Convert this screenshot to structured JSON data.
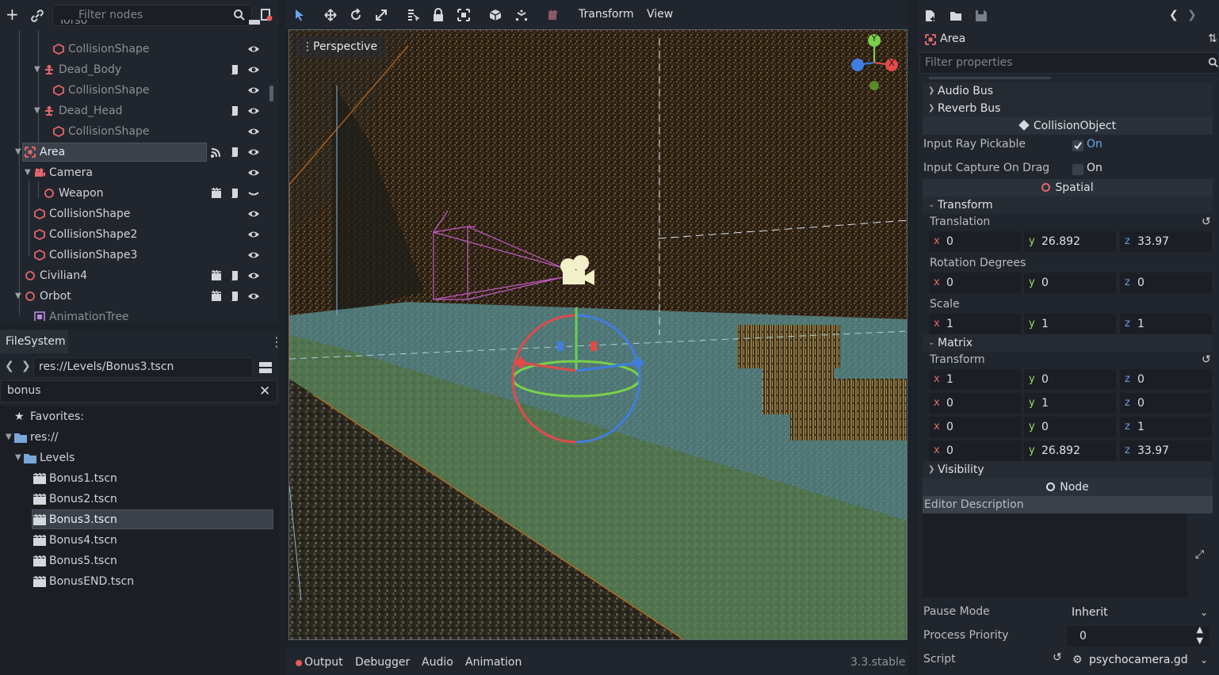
{
  "scene": {
    "filter_placeholder": "Filter nodes",
    "nodes": [
      {
        "label": "Torso"
      },
      {
        "label": "CollisionShape"
      },
      {
        "label": "Dead_Body"
      },
      {
        "label": "CollisionShape"
      },
      {
        "label": "Dead_Head"
      },
      {
        "label": "CollisionShape"
      },
      {
        "label": "Area"
      },
      {
        "label": "Camera"
      },
      {
        "label": "Weapon"
      },
      {
        "label": "CollisionShape"
      },
      {
        "label": "CollisionShape2"
      },
      {
        "label": "CollisionShape3"
      },
      {
        "label": "Civilian4"
      },
      {
        "label": "Orbot"
      },
      {
        "label": "AnimationTree"
      }
    ]
  },
  "filesystem": {
    "tab": "FileSystem",
    "path": "res://Levels/Bonus3.tscn",
    "search": "bonus",
    "favorites": "Favorites:",
    "root": "res://",
    "folder": "Levels",
    "files": [
      "Bonus1.tscn",
      "Bonus2.tscn",
      "Bonus3.tscn",
      "Bonus4.tscn",
      "Bonus5.tscn",
      "BonusEND.tscn"
    ],
    "selected_file": "Bonus3.tscn"
  },
  "viewport": {
    "menu_transform": "Transform",
    "menu_view": "View",
    "perspective": "Perspective",
    "gizmo": {
      "y": "Y",
      "x": "X"
    }
  },
  "bottom": {
    "tabs": [
      "Output",
      "Debugger",
      "Audio",
      "Animation"
    ],
    "version": "3.3.stable"
  },
  "inspector": {
    "node_name": "Area",
    "filter_placeholder": "Filter properties",
    "audio_bus": "Audio Bus",
    "reverb_bus": "Reverb Bus",
    "collision_object": "CollisionObject",
    "input_ray_pickable": {
      "label": "Input Ray Pickable",
      "value": "On"
    },
    "input_capture": {
      "label": "Input Capture On Drag",
      "value": "On"
    },
    "spatial": "Spatial",
    "transform_cat": "Transform",
    "translation": {
      "label": "Translation",
      "x": "0",
      "y": "26.892",
      "z": "33.97"
    },
    "rotation": {
      "label": "Rotation Degrees",
      "x": "0",
      "y": "0",
      "z": "0"
    },
    "scale": {
      "label": "Scale",
      "x": "1",
      "y": "1",
      "z": "1"
    },
    "matrix_cat": "Matrix",
    "matrix_transform": "Transform",
    "matrix_rows": [
      {
        "x": "1",
        "y": "0",
        "z": "0"
      },
      {
        "x": "0",
        "y": "1",
        "z": "0"
      },
      {
        "x": "0",
        "y": "0",
        "z": "1"
      },
      {
        "x": "0",
        "y": "26.892",
        "z": "33.97"
      }
    ],
    "visibility": "Visibility",
    "node": "Node",
    "editor_description": "Editor Description",
    "pause_mode": {
      "label": "Pause Mode",
      "value": "Inherit"
    },
    "process_priority": {
      "label": "Process Priority",
      "value": "0"
    },
    "script": {
      "label": "Script",
      "value": "psychocamera.gd"
    },
    "axis_labels": {
      "x": "x",
      "y": "y",
      "z": "z"
    }
  }
}
